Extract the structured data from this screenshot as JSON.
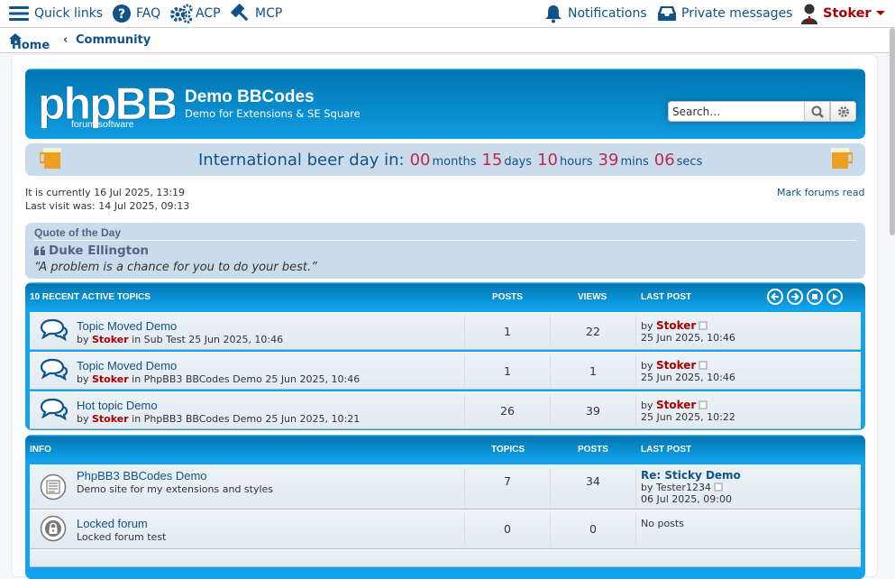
{
  "nav": {
    "quick_links": "Quick links",
    "faq": "FAQ",
    "acp": "ACP",
    "mcp": "MCP",
    "notifications": "Notifications",
    "private_messages": "Private messages",
    "username": "Stoker"
  },
  "breadcrumb": {
    "home": "Home",
    "community": "Community"
  },
  "header": {
    "logo_text": "phpBB",
    "logo_sub": "forum software",
    "site_title": "Demo BBCodes",
    "site_desc": "Demo for Extensions & SE Square",
    "search_placeholder": "Search…"
  },
  "countdown": {
    "label": "International beer day in:",
    "months": "00",
    "months_unit": "months",
    "days": "15",
    "days_unit": "days",
    "hours": "10",
    "hours_unit": "hours",
    "mins": "39",
    "mins_unit": "mins",
    "secs": "06",
    "secs_unit": "secs"
  },
  "info": {
    "current_time": "It is currently 16 Jul 2025, 13:19",
    "last_visit": "Last visit was: 14 Jul 2025, 09:13",
    "mark_read": "Mark forums read"
  },
  "quote": {
    "title": "Quote of the Day",
    "author": "Duke Ellington",
    "text": "“A problem is a chance for you to do your best.”"
  },
  "recent": {
    "heading": "10 Recent active topics",
    "col_posts": "Posts",
    "col_views": "Views",
    "col_last": "Last post",
    "rows": [
      {
        "title": "Topic Moved Demo",
        "by": "by",
        "author": "Stoker",
        "in": "in Sub Test 25 Jun 2025, 10:46",
        "posts": "1",
        "views": "22",
        "lp_by": "by",
        "lp_user": "Stoker",
        "lp_date": "25 Jun 2025, 10:46"
      },
      {
        "title": "Topic Moved Demo",
        "by": "by",
        "author": "Stoker",
        "in": "in PhpBB3 BBCodes Demo 25 Jun 2025, 10:46",
        "posts": "1",
        "views": "1",
        "lp_by": "by",
        "lp_user": "Stoker",
        "lp_date": "25 Jun 2025, 10:46"
      },
      {
        "title": "Hot topic Demo",
        "by": "by",
        "author": "Stoker",
        "in": "in PhpBB3 BBCodes Demo 25 Jun 2025, 10:21",
        "posts": "26",
        "views": "39",
        "lp_by": "by",
        "lp_user": "Stoker",
        "lp_date": "25 Jun 2025, 10:22"
      }
    ]
  },
  "forums": {
    "heading": "Info",
    "col_topics": "Topics",
    "col_posts": "Posts",
    "col_last": "Last post",
    "rows": [
      {
        "title": "PhpBB3 BBCodes Demo",
        "desc": "Demo site for my extensions and styles",
        "topics": "7",
        "posts": "34",
        "lp_title": "Re: Sticky Demo",
        "lp_by": "by Tester1234",
        "lp_date": "06 Jul 2025, 09:00"
      },
      {
        "title": "Locked forum",
        "desc": "Locked forum test",
        "topics": "0",
        "posts": "0",
        "lp_none": "No posts"
      }
    ]
  }
}
